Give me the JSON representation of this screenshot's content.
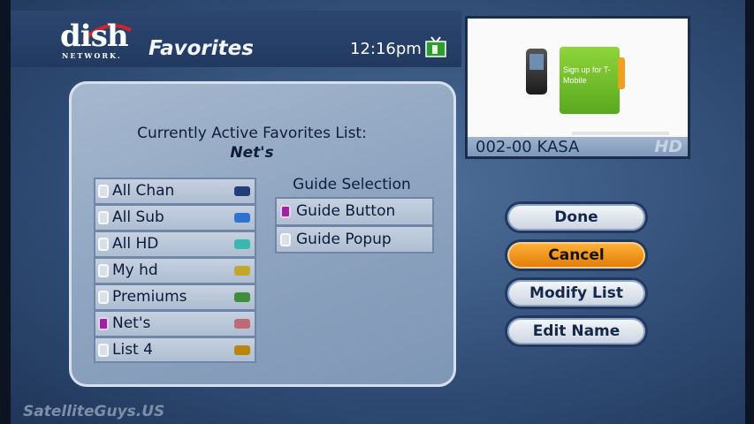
{
  "header": {
    "logo_text": "dish",
    "logo_subtext": "NETWORK.",
    "title": "Favorites",
    "clock": "12:16pm",
    "tv_icon": "tv-icon"
  },
  "preview": {
    "channel": "002-00 KASA",
    "hd_badge": "HD",
    "ad_text": "Sign up for T-Mobile"
  },
  "panel": {
    "active_label": "Currently Active Favorites List:",
    "active_name": "Net's",
    "lists": [
      {
        "label": "All Chan",
        "color": "#1f3e7a",
        "selected": false
      },
      {
        "label": "All Sub",
        "color": "#2f73d0",
        "selected": false
      },
      {
        "label": "All HD",
        "color": "#39b8b0",
        "selected": false
      },
      {
        "label": "My hd",
        "color": "#c3a72a",
        "selected": false
      },
      {
        "label": "Premiums",
        "color": "#3f8f3a",
        "selected": false
      },
      {
        "label": "Net's",
        "color": "#c06a78",
        "selected": true
      },
      {
        "label": "List 4",
        "color": "#b8860b",
        "selected": false
      }
    ],
    "guide_title": "Guide Selection",
    "guide_options": [
      {
        "label": "Guide Button",
        "selected": true
      },
      {
        "label": "Guide Popup",
        "selected": false
      }
    ]
  },
  "buttons": {
    "done": "Done",
    "cancel": "Cancel",
    "modify": "Modify List",
    "edit": "Edit Name"
  },
  "watermark": "SatelliteGuys.US"
}
